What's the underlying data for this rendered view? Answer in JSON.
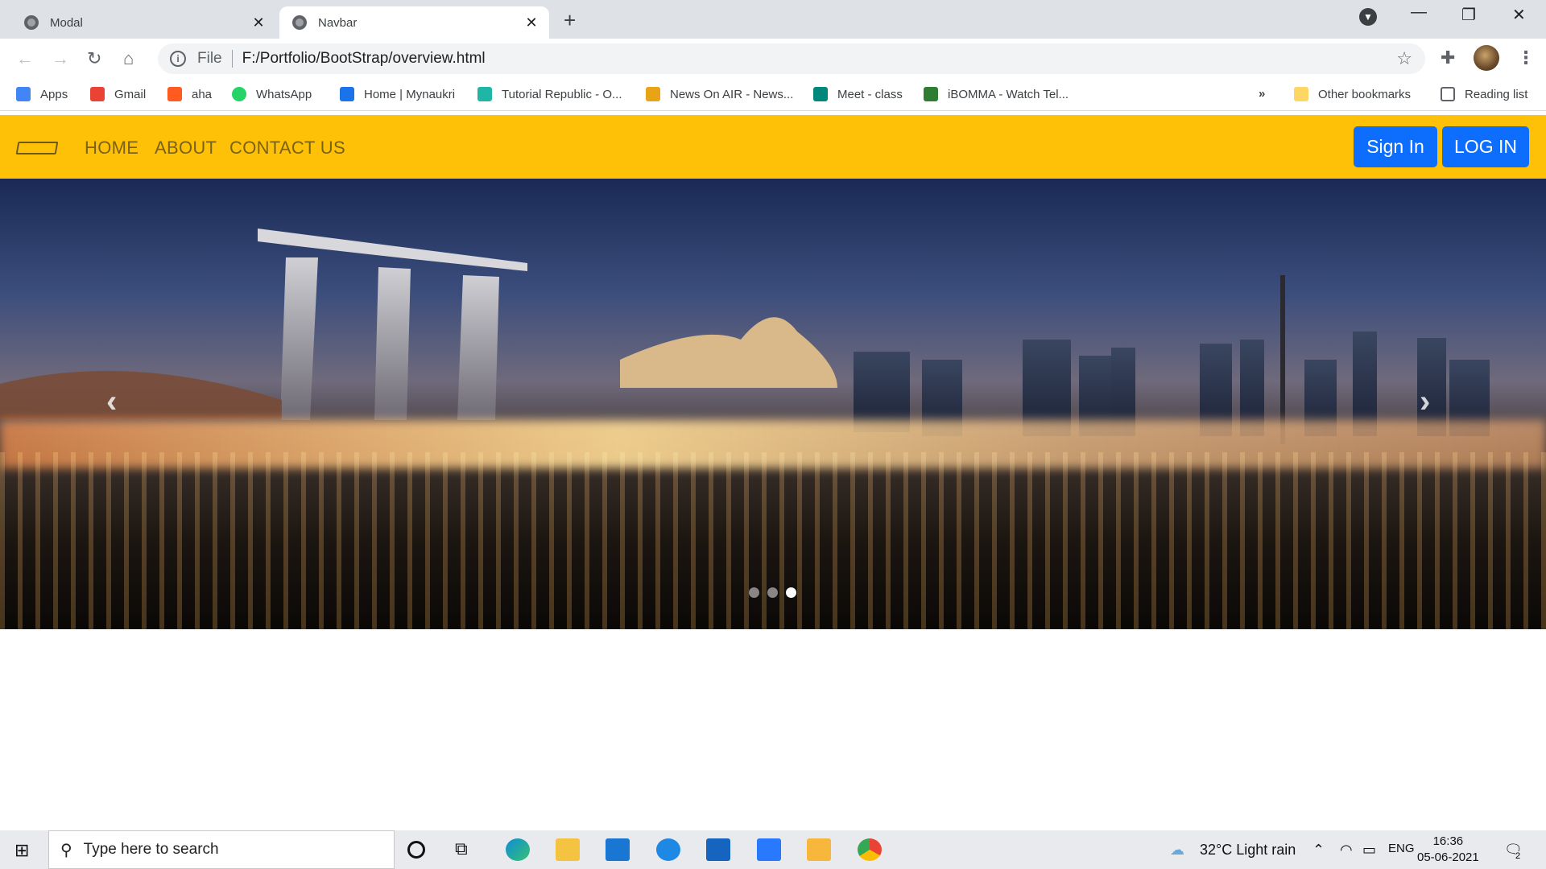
{
  "browser": {
    "tabs": [
      {
        "label": "Modal",
        "active": false
      },
      {
        "label": "Navbar",
        "active": true
      }
    ],
    "file_label": "File",
    "url": "F:/Portfolio/BootStrap/overview.html",
    "bookmarks": [
      {
        "label": "Apps",
        "color": "#4285f4"
      },
      {
        "label": "Gmail",
        "color": "#ea4335"
      },
      {
        "label": "aha",
        "color": "#ff5a1f"
      },
      {
        "label": "WhatsApp",
        "color": "#25d366"
      },
      {
        "label": "Home | Mynaukri",
        "color": "#1a73e8"
      },
      {
        "label": "Tutorial Republic - O...",
        "color": "#1fb6a6"
      },
      {
        "label": "News On AIR - News...",
        "color": "#e8a317"
      },
      {
        "label": "Meet - class",
        "color": "#00897b"
      },
      {
        "label": "iBOMMA - Watch Tel...",
        "color": "#2e7d32"
      }
    ],
    "overflow": "»",
    "other_bookmarks": "Other bookmarks",
    "reading_list": "Reading list"
  },
  "site": {
    "nav": {
      "links": [
        "HOME",
        "ABOUT",
        "CONTACT US"
      ],
      "sign_in": "Sign In",
      "log_in": "LOG IN",
      "color": "#ffc107",
      "button_color": "#0d6efd"
    },
    "carousel": {
      "slides": 3,
      "active_slide": 3,
      "prev": "‹",
      "next": "›"
    }
  },
  "taskbar": {
    "search_placeholder": "Type here to search",
    "weather": "32°C  Light rain",
    "lang": "ENG",
    "time": "16:36",
    "date": "05-06-2021",
    "notifications": "2"
  }
}
